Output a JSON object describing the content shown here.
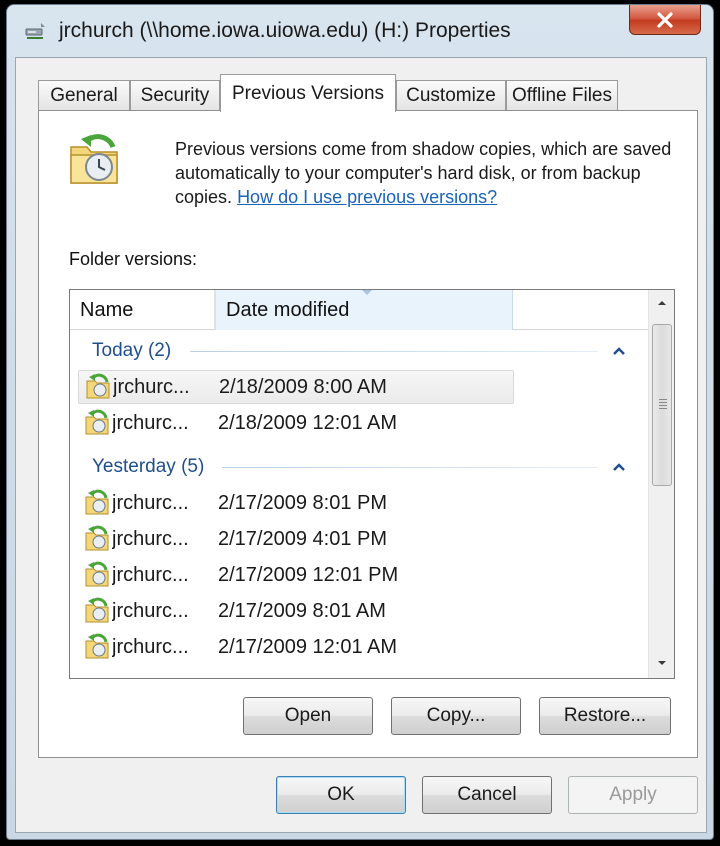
{
  "window": {
    "title": "jrchurch (\\\\home.iowa.uiowa.edu) (H:) Properties"
  },
  "tabs": [
    {
      "label": "General",
      "active": false
    },
    {
      "label": "Security",
      "active": false
    },
    {
      "label": "Previous Versions",
      "active": true
    },
    {
      "label": "Customize",
      "active": false
    },
    {
      "label": "Offline Files",
      "active": false
    }
  ],
  "description": {
    "text": "Previous versions come from shadow copies, which are saved automatically to your computer's hard disk, or from backup copies.",
    "link": "How do I use previous versions?"
  },
  "folder_versions": {
    "label": "Folder versions:",
    "columns": [
      "Name",
      "Date modified"
    ],
    "sorted_column": "Date modified",
    "groups": [
      {
        "label": "Today (2)",
        "rows": [
          {
            "name": "jrchurc...",
            "date": "2/18/2009 8:00 AM",
            "selected": true
          },
          {
            "name": "jrchurc...",
            "date": "2/18/2009 12:01 AM",
            "selected": false
          }
        ]
      },
      {
        "label": "Yesterday (5)",
        "rows": [
          {
            "name": "jrchurc...",
            "date": "2/17/2009 8:01 PM",
            "selected": false
          },
          {
            "name": "jrchurc...",
            "date": "2/17/2009 4:01 PM",
            "selected": false
          },
          {
            "name": "jrchurc...",
            "date": "2/17/2009 12:01 PM",
            "selected": false
          },
          {
            "name": "jrchurc...",
            "date": "2/17/2009 8:01 AM",
            "selected": false
          },
          {
            "name": "jrchurc...",
            "date": "2/17/2009 12:01 AM",
            "selected": false
          }
        ]
      }
    ]
  },
  "action_buttons": {
    "open": "Open",
    "copy": "Copy...",
    "restore": "Restore..."
  },
  "dialog_buttons": {
    "ok": "OK",
    "cancel": "Cancel",
    "apply": "Apply",
    "apply_enabled": false
  },
  "colors": {
    "link": "#1a63b8",
    "group_header": "#1f4e8c",
    "close_button": "#c23a20"
  },
  "icons": {
    "title": "drive-network-icon",
    "close": "close-icon",
    "header": "restore-folder-icon",
    "row": "shadow-copy-folder-icon"
  }
}
